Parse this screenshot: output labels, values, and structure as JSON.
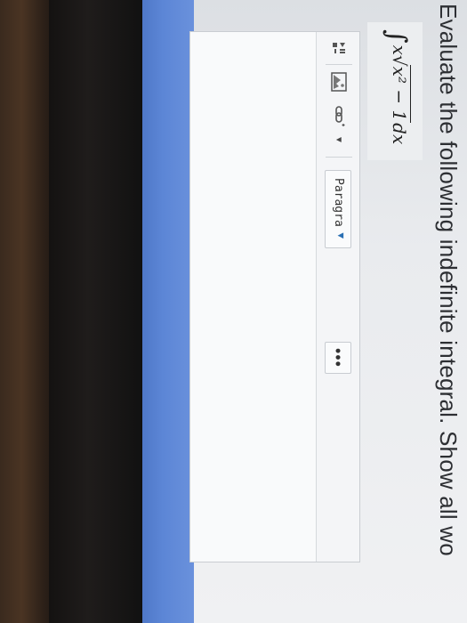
{
  "question": {
    "prompt": "Evaluate the following indefinite integral. Show all wo",
    "expression": {
      "integral_sign": "∫",
      "coefficient": "x",
      "radicand": "x² − 1",
      "differential": "dx"
    }
  },
  "toolbar": {
    "paragraph_label": "Paragra",
    "dropdown_caret": "▼",
    "more_label": "•••",
    "extra_caret": "▼"
  },
  "icons": {
    "media": "media-icon",
    "image": "image-icon",
    "link": "link-icon"
  },
  "colors": {
    "accent_blue": "#5c86d6",
    "screen_bg": "#eceef0"
  }
}
